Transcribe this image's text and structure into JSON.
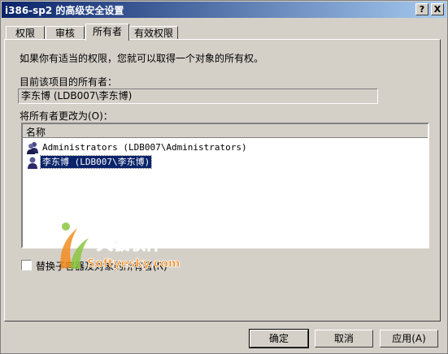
{
  "window": {
    "title": "i386-sp2 的高级安全设置",
    "help_btn": "?",
    "close_btn": "X"
  },
  "tabs": [
    {
      "label": "权限"
    },
    {
      "label": "审核"
    },
    {
      "label": "所有者",
      "active": true
    },
    {
      "label": "有效权限"
    }
  ],
  "owner_page": {
    "intro": "如果你有适当的权限，您就可以取得一个对象的所有权。",
    "current_owner_label": "目前该项目的所有者：",
    "current_owner_value": "李东博 (LDB007\\李东博)",
    "change_label": "将所有者更改为(O)：",
    "list_header": "名称",
    "list_items": [
      {
        "label": "Administrators (LDB007\\Administrators)",
        "icon": "group-icon",
        "selected": false
      },
      {
        "label": "李东博 (LDB007\\李东博)",
        "icon": "user-icon",
        "selected": true
      }
    ],
    "replace_checkbox_label": "替换子容器及对象的所有者(R)",
    "replace_checked": false
  },
  "watermark": {
    "brand": "天极软件",
    "domain": "Softyesky.com"
  },
  "buttons": {
    "ok": "确定",
    "cancel": "取消",
    "apply": "应用(A)"
  }
}
